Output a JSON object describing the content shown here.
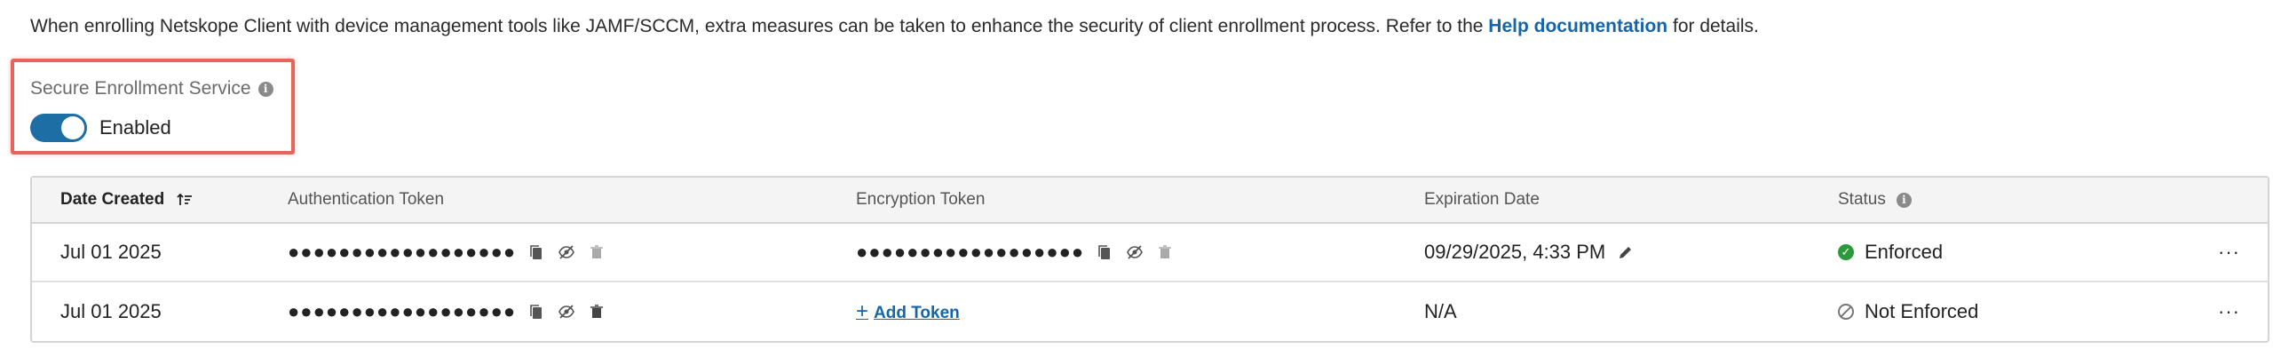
{
  "intro": {
    "text": "When enrolling Netskope Client with device management tools like JAMF/SCCM, extra measures can be taken to enhance the security of client enrollment process. Refer to the",
    "link": "Help documentation",
    "suffix": "for details."
  },
  "secure_enrollment": {
    "label": "Secure Enrollment Service",
    "toggle_state": "Enabled",
    "enabled": true
  },
  "table": {
    "headers": {
      "date_created": "Date Created",
      "auth_token": "Authentication Token",
      "enc_token": "Encryption Token",
      "expiration": "Expiration Date",
      "status": "Status"
    },
    "rows": [
      {
        "date_created": "Jul 01 2025",
        "auth_token": "●●●●●●●●●●●●●●●●●●",
        "enc_token": "●●●●●●●●●●●●●●●●●●",
        "expiration": "09/29/2025, 4:33 PM",
        "status": "Enforced"
      },
      {
        "date_created": "Jul 01 2025",
        "auth_token": "●●●●●●●●●●●●●●●●●●",
        "enc_token_action": "Add Token",
        "expiration": "N/A",
        "status": "Not Enforced"
      }
    ],
    "more_label": "···"
  },
  "colors": {
    "accent": "#1565a8",
    "toggle_on": "#1c6ea4",
    "highlight": "#e8645b",
    "enforced": "#2a9a3a"
  }
}
